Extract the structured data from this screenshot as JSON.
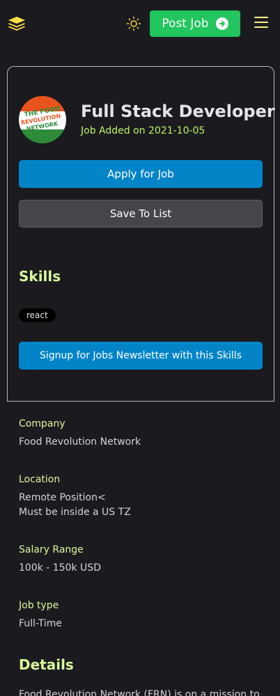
{
  "header": {
    "logo_icon": "layers-icon",
    "theme_icon": "sun-icon",
    "post_job_label": "Post Job",
    "post_job_icon": "arrow-right-circle-icon",
    "menu_icon": "hamburger-menu-icon",
    "accent_color": "#22c55e"
  },
  "job": {
    "company_logo_text": [
      "THE FOOD",
      "REVOLUTION",
      "NETWORK"
    ],
    "title": "Full Stack Developer",
    "added": "Job Added on 2021-10-05",
    "apply_label": "Apply for Job",
    "save_label": "Save To List"
  },
  "skills": {
    "heading": "Skills",
    "tags": [
      "react"
    ],
    "newsletter_label": "Signup for Jobs Newsletter with this Skills"
  },
  "info": {
    "company_label": "Company",
    "company_value": "Food Revolution Network",
    "location_label": "Location",
    "location_line1": "Remote Position<",
    "location_line2": "Must be inside a US TZ",
    "salary_label": "Salary Range",
    "salary_value": "100k - 150k USD",
    "jobtype_label": "Job type",
    "jobtype_value": "Full-Time"
  },
  "details": {
    "heading": "Details",
    "text_preview": "Food Revolution Network (FRN) is on a mission to"
  }
}
